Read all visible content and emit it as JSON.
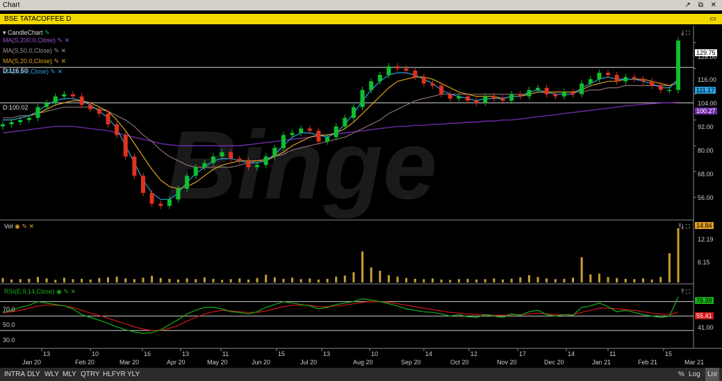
{
  "window": {
    "title": "Chart",
    "controls": [
      "↗",
      "⧉",
      "✕"
    ]
  },
  "symbol_bar": {
    "title": "BSE TATACOFFEE D",
    "icon": "▭"
  },
  "legend": {
    "candle": "CandleChart",
    "ma200": "MA(S,200.0,Close)",
    "ma50": "MA(S,50.0,Close)",
    "ma20": "MA(S,20.0,Close)",
    "ma9": "MA(S,9.0,Close)",
    "d_label": "D:116.50",
    "hline_label": "D:100.02",
    "vol": "Vol",
    "rsi": "RSI(E,9,14,Close)"
  },
  "colors": {
    "up": "#0fbf2f",
    "down": "#e0321c",
    "ma200": "#6f2aa8",
    "ma50": "#8a7070",
    "ma20": "#e0a020",
    "ma9": "#28a0e0",
    "vol": "#c8a030",
    "rsi": "#18b018",
    "rsi_sig": "#d01818"
  },
  "price_axis": {
    "ticks": [
      "128.00",
      "116.00",
      "104.00",
      "92.00",
      "80.00",
      "68.00",
      "56.00"
    ],
    "last": "129.75",
    "ma9_val": "111.17",
    "ma200_val": "100.27"
  },
  "vol_axis": {
    "ticks": [
      "12.19",
      "6.15"
    ],
    "last": "14.84"
  },
  "rsi_axis": {
    "ticks": [
      "41.00"
    ],
    "left_ticks": [
      "70.0",
      "50.0",
      "30.0"
    ],
    "last": "76.39",
    "sig": "55.41"
  },
  "x_axis": {
    "days": [
      "13",
      "10",
      "16",
      "13",
      "11",
      "15",
      "13",
      "10",
      "14",
      "12",
      "17",
      "14",
      "11",
      "15"
    ],
    "months": [
      "Jan 20",
      "Feb 20",
      "Mar 20",
      "Apr 20",
      "May 20",
      "Jun 20",
      "Jul 20",
      "Aug 20",
      "Sep 20",
      "Oct 20",
      "Nov 20",
      "Dec 20",
      "Jan 21",
      "Feb 21",
      "Mar 21"
    ]
  },
  "bottom": {
    "timeframes": [
      "INTRA",
      "DLY",
      "WLY",
      "MLY",
      "QTRY",
      "HLFYR",
      "YLY"
    ],
    "right": [
      "%",
      "Log",
      "Lnr"
    ]
  },
  "watermark": "Binge",
  "chart_data": {
    "type": "line",
    "title": "BSE TATACOFFEE D",
    "ylim": [
      48,
      134
    ],
    "close": [
      90,
      91,
      92,
      93,
      98,
      100,
      103,
      104,
      103,
      99,
      97,
      95,
      90,
      85,
      75,
      66,
      58,
      53,
      52,
      55,
      60,
      66,
      70,
      72,
      75,
      77,
      74,
      73,
      70,
      71,
      75,
      79,
      85,
      86,
      88,
      87,
      82,
      84,
      89,
      93,
      98,
      106,
      110,
      113,
      117,
      116,
      115,
      112,
      109,
      108,
      104,
      102,
      103,
      101,
      100,
      103,
      102,
      101,
      104,
      103,
      106,
      107,
      104,
      103,
      105,
      104,
      109,
      111,
      114,
      113,
      110,
      112,
      111,
      110,
      108,
      106,
      106,
      129
    ],
    "ma9": [
      92,
      92,
      93,
      94,
      96,
      99,
      101,
      102,
      102,
      101,
      99,
      96,
      93,
      88,
      80,
      72,
      64,
      58,
      55,
      55,
      58,
      63,
      67,
      70,
      73,
      74,
      74,
      73,
      72,
      72,
      73,
      76,
      80,
      84,
      86,
      86,
      85,
      84,
      86,
      90,
      95,
      101,
      106,
      110,
      113,
      114,
      114,
      113,
      111,
      109,
      106,
      104,
      103,
      102,
      101,
      102,
      102,
      102,
      103,
      103,
      105,
      106,
      105,
      104,
      104,
      104,
      107,
      109,
      111,
      112,
      111,
      111,
      111,
      110,
      109,
      107,
      107,
      111
    ],
    "ma20": [
      92,
      92,
      93,
      94,
      95,
      97,
      99,
      100,
      101,
      101,
      100,
      98,
      96,
      92,
      87,
      81,
      75,
      69,
      64,
      61,
      60,
      61,
      63,
      66,
      69,
      71,
      72,
      73,
      73,
      73,
      73,
      75,
      77,
      80,
      82,
      84,
      85,
      85,
      86,
      88,
      91,
      95,
      99,
      103,
      107,
      110,
      111,
      112,
      112,
      111,
      109,
      107,
      105,
      104,
      103,
      103,
      103,
      102,
      103,
      103,
      104,
      105,
      105,
      105,
      105,
      105,
      106,
      108,
      109,
      110,
      110,
      111,
      111,
      111,
      110,
      109,
      108,
      110
    ],
    "ma50": [
      93,
      93,
      94,
      94,
      95,
      96,
      97,
      98,
      98,
      98,
      98,
      97,
      96,
      94,
      92,
      89,
      85,
      82,
      78,
      75,
      73,
      71,
      70,
      70,
      70,
      70,
      70,
      71,
      72,
      73,
      74,
      75,
      76,
      78,
      79,
      80,
      81,
      82,
      83,
      84,
      86,
      88,
      90,
      92,
      95,
      97,
      99,
      101,
      102,
      103,
      104,
      104,
      104,
      104,
      104,
      104,
      104,
      104,
      104,
      104,
      104,
      105,
      105,
      105,
      105,
      105,
      105,
      106,
      106,
      107,
      107,
      108,
      108,
      108,
      108,
      108,
      108,
      109
    ],
    "ma200": [
      86,
      86.5,
      87,
      87.5,
      88,
      88.5,
      89,
      89,
      89,
      88.5,
      88,
      87.5,
      87,
      86,
      85,
      84,
      83,
      82,
      81,
      80.5,
      80,
      80,
      80,
      80,
      80,
      80,
      80,
      80,
      80.5,
      81,
      81.5,
      82,
      82.5,
      83,
      83.5,
      84,
      84.5,
      85,
      85.5,
      86,
      86.5,
      87,
      87.5,
      88,
      88.5,
      89,
      89,
      89.5,
      89.5,
      90,
      90,
      90.5,
      90.5,
      91,
      91,
      91.5,
      91.5,
      92,
      92,
      92.5,
      93,
      93.5,
      94,
      94.5,
      95,
      95.5,
      96,
      96.5,
      97,
      97.5,
      98,
      98.5,
      99,
      99.3,
      99.6,
      99.9,
      100.1,
      100.27
    ],
    "volume": [
      1.2,
      0.8,
      0.9,
      1.0,
      1.5,
      1.1,
      0.7,
      1.3,
      0.9,
      1.0,
      0.8,
      1.2,
      1.4,
      1.6,
      1.1,
      0.9,
      1.3,
      1.8,
      1.2,
      1.0,
      0.8,
      1.1,
      0.9,
      1.4,
      1.0,
      0.7,
      0.9,
      1.1,
      0.8,
      1.2,
      2.1,
      1.4,
      1.0,
      1.3,
      0.9,
      1.1,
      0.8,
      1.0,
      1.6,
      1.9,
      2.8,
      8.5,
      4.1,
      3.2,
      2.0,
      1.6,
      1.2,
      1.0,
      0.9,
      1.1,
      0.8,
      0.7,
      0.9,
      1.0,
      0.8,
      0.9,
      1.1,
      0.8,
      1.0,
      1.4,
      2.0,
      1.5,
      1.1,
      0.9,
      1.0,
      1.3,
      6.9,
      2.2,
      2.4,
      1.5,
      1.2,
      1.0,
      0.9,
      1.1,
      0.8,
      1.5,
      8.0,
      14.84
    ],
    "rsi": [
      55,
      58,
      62,
      65,
      70,
      68,
      66,
      64,
      60,
      52,
      48,
      44,
      40,
      35,
      31,
      28,
      26,
      27,
      31,
      38,
      45,
      53,
      58,
      62,
      62,
      60,
      56,
      55,
      53,
      56,
      62,
      66,
      70,
      68,
      66,
      64,
      60,
      62,
      66,
      68,
      70,
      74,
      72,
      70,
      67,
      64,
      60,
      58,
      56,
      55,
      53,
      50,
      52,
      49,
      48,
      52,
      50,
      48,
      53,
      51,
      56,
      58,
      52,
      50,
      52,
      51,
      62,
      64,
      68,
      63,
      56,
      58,
      55,
      52,
      50,
      48,
      50,
      76.39
    ],
    "rsi_signal": [
      54,
      56,
      58,
      61,
      64,
      65,
      65,
      64,
      62,
      58,
      54,
      51,
      47,
      43,
      39,
      35,
      32,
      30,
      30,
      33,
      37,
      43,
      48,
      53,
      56,
      58,
      57,
      56,
      55,
      55,
      57,
      60,
      63,
      65,
      65,
      65,
      63,
      63,
      64,
      65,
      67,
      69,
      70,
      70,
      69,
      67,
      65,
      63,
      61,
      59,
      57,
      55,
      54,
      53,
      52,
      52,
      51,
      51,
      52,
      52,
      53,
      54,
      53,
      52,
      52,
      52,
      55,
      58,
      61,
      61,
      60,
      59,
      58,
      56,
      54,
      53,
      52,
      55.41
    ]
  }
}
